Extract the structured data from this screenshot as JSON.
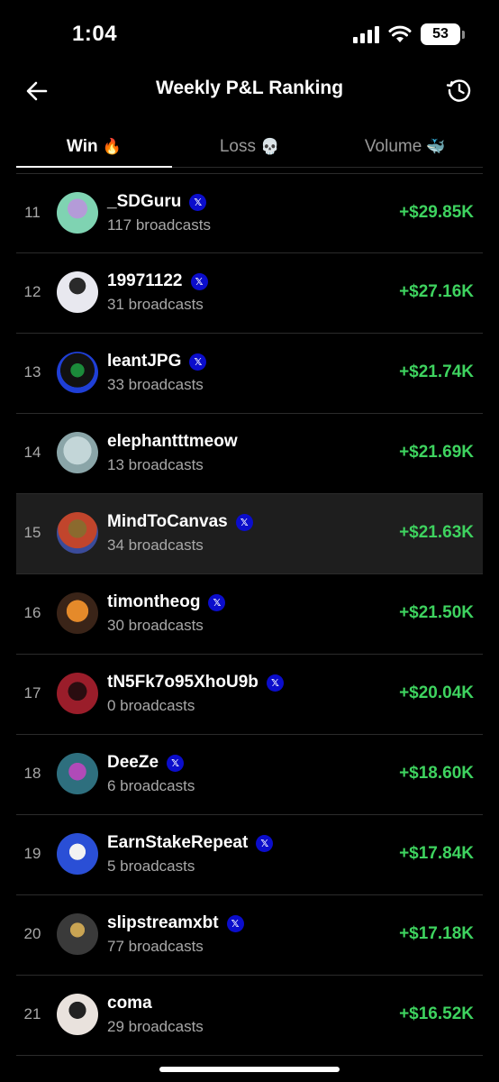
{
  "status_bar": {
    "time": "1:04",
    "battery": "53"
  },
  "header": {
    "title": "Weekly P&L Ranking",
    "back_icon": "arrow-left-icon",
    "history_icon": "history-icon"
  },
  "tabs": [
    {
      "label": "Win",
      "emoji": "🔥",
      "active": true
    },
    {
      "label": "Loss",
      "emoji": "💀",
      "active": false
    },
    {
      "label": "Volume",
      "emoji": "🐳",
      "active": false
    }
  ],
  "colors": {
    "background": "#000000",
    "positive": "#3ed35f",
    "x_badge": "#0b0dcc",
    "muted": "#a8a8a8",
    "highlight_row": "#1e1e1e"
  },
  "x_badge_label": "𝕏",
  "rows": [
    {
      "rank": "11",
      "name": "_SDGuru",
      "verified": true,
      "broadcasts": "117 broadcasts",
      "pnl": "+$29.85K"
    },
    {
      "rank": "12",
      "name": "19971122",
      "verified": true,
      "broadcasts": "31 broadcasts",
      "pnl": "+$27.16K"
    },
    {
      "rank": "13",
      "name": "leantJPG",
      "verified": true,
      "broadcasts": "33 broadcasts",
      "pnl": "+$21.74K"
    },
    {
      "rank": "14",
      "name": "elephantttmeow",
      "verified": false,
      "broadcasts": "13 broadcasts",
      "pnl": "+$21.69K"
    },
    {
      "rank": "15",
      "name": "MindToCanvas",
      "verified": true,
      "broadcasts": "34 broadcasts",
      "pnl": "+$21.63K",
      "highlight": true
    },
    {
      "rank": "16",
      "name": "timontheog",
      "verified": true,
      "broadcasts": "30 broadcasts",
      "pnl": "+$21.50K"
    },
    {
      "rank": "17",
      "name": "tN5Fk7o95XhoU9b",
      "verified": true,
      "broadcasts": "0 broadcasts",
      "pnl": "+$20.04K"
    },
    {
      "rank": "18",
      "name": "DeeZe",
      "verified": true,
      "broadcasts": "6 broadcasts",
      "pnl": "+$18.60K"
    },
    {
      "rank": "19",
      "name": "EarnStakeRepeat",
      "verified": true,
      "broadcasts": "5 broadcasts",
      "pnl": "+$17.84K"
    },
    {
      "rank": "20",
      "name": "slipstreamxbt",
      "verified": true,
      "broadcasts": "77 broadcasts",
      "pnl": "+$17.18K"
    },
    {
      "rank": "21",
      "name": "coma",
      "verified": false,
      "broadcasts": "29 broadcasts",
      "pnl": "+$16.52K"
    }
  ]
}
